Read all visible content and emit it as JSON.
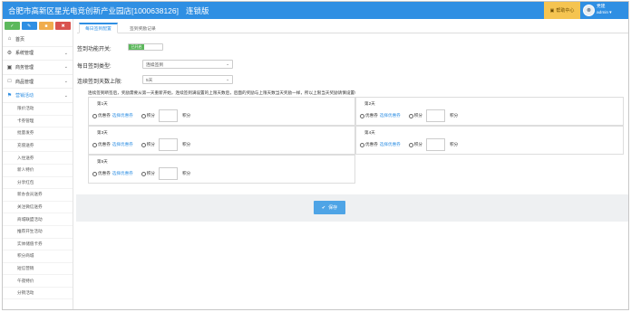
{
  "header": {
    "store_name": "合肥市高新区星光电竞创新产业园店[1000638126]",
    "edition": "连锁版",
    "help_label": "帮助中心",
    "user_role": "党建",
    "user_name": "admin"
  },
  "sidebar": {
    "items": [
      {
        "label": "首页",
        "icon": "home-icon"
      },
      {
        "label": "系统管理",
        "icon": "gear-icon"
      },
      {
        "label": "商务管理",
        "icon": "briefcase-icon"
      },
      {
        "label": "商品管理",
        "icon": "box-icon"
      },
      {
        "label": "营销活动",
        "icon": "gift-icon"
      }
    ],
    "sub_items": [
      "限价活动",
      "卡券管理",
      "批量发券",
      "充值送券",
      "入住送券",
      "新人特价",
      "分享红包",
      "新办会员送券",
      "关注微信送券",
      "商城联盟活动",
      "推荐开生活动",
      "实体储值卡券",
      "积分商城",
      "短信营销",
      "午夜特价",
      "分销活动"
    ]
  },
  "tabs": [
    "每日签到配置",
    "签到奖励记录"
  ],
  "form": {
    "switch_label": "签到功能开关:",
    "switch_state": "已开启",
    "type_label": "每日签到类型:",
    "type_value": "连续签到",
    "limit_label": "连续签到天数上限:",
    "limit_value": "5天"
  },
  "note": "连续签到断签后，奖励需要从第一天重新开始，连续签到满设置的上限天数后，后面的奖励与上限天数当天奖励一样，所以上限当天奖励请慎设置!",
  "days": [
    {
      "title": "第1天"
    },
    {
      "title": "第2天"
    },
    {
      "title": "第3天"
    },
    {
      "title": "第4天"
    },
    {
      "title": "第5天"
    }
  ],
  "reward": {
    "coupon_label": "优惠券",
    "select_link": "选择优惠券",
    "points_label": "积分",
    "points_unit": "积分"
  },
  "save_label": "保存"
}
